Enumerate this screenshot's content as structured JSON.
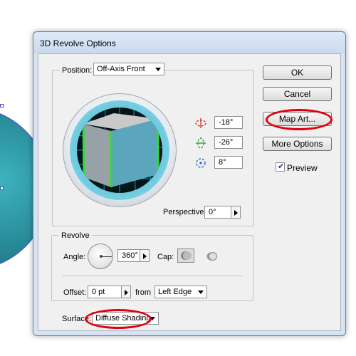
{
  "window": {
    "title": "3D Revolve Options"
  },
  "position": {
    "label": "Position:",
    "preset_value": "Off-Axis Front",
    "x_rotation": "-18°",
    "y_rotation": "-26°",
    "z_rotation": "8°",
    "perspective_label": "Perspective:",
    "perspective_value": "0°"
  },
  "buttons": {
    "ok": "OK",
    "cancel": "Cancel",
    "map_art": "Map Art...",
    "more_options": "More Options"
  },
  "preview": {
    "label": "Preview",
    "checked": true
  },
  "revolve": {
    "legend": "Revolve",
    "angle_label": "Angle:",
    "angle_value": "360°",
    "cap_label": "Cap:",
    "offset_label": "Offset:",
    "offset_value": "0 pt",
    "from_label": "from",
    "from_value": "Left Edge"
  },
  "surface": {
    "label": "Surface:",
    "value": "Diffuse Shading"
  },
  "colors": {
    "cube_front": "#5ba6bc",
    "cube_top": "#c9c9c9",
    "cube_side": "#98a0a8",
    "cube_edge": "#35d83a",
    "highlight_ring": "#e00010",
    "grid_line": "#2aa6c6"
  }
}
